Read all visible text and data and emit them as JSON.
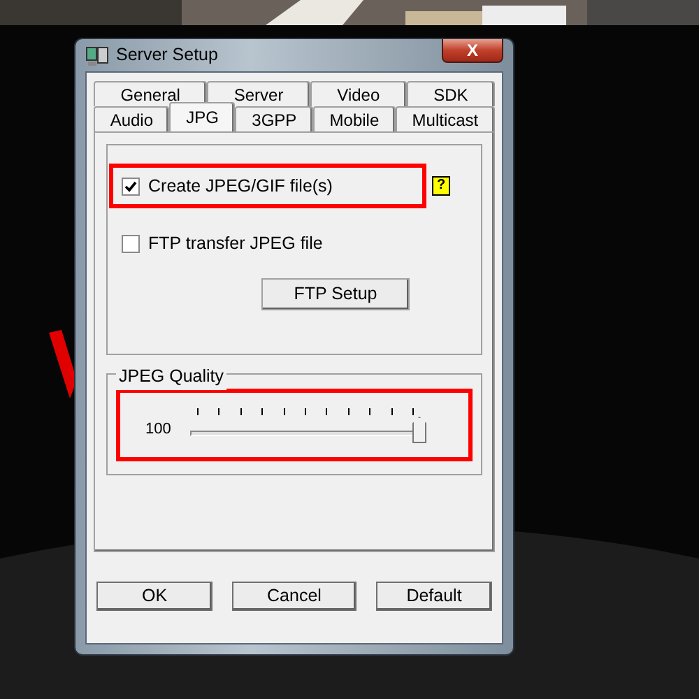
{
  "window": {
    "title": "Server Setup",
    "close": "X"
  },
  "tabs": [
    [
      {
        "label": "General",
        "selected": false
      },
      {
        "label": "Server",
        "selected": false
      },
      {
        "label": "Video",
        "selected": false
      },
      {
        "label": "SDK",
        "selected": false
      }
    ],
    [
      {
        "label": "Audio",
        "selected": false
      },
      {
        "label": "JPG",
        "selected": true
      },
      {
        "label": "3GPP",
        "selected": false
      },
      {
        "label": "Mobile",
        "selected": false
      },
      {
        "label": "Multicast",
        "selected": false
      }
    ]
  ],
  "options": [
    {
      "label": "Create JPEG/GIF file(s)",
      "checked": true,
      "highlighted": true,
      "help": "?"
    },
    {
      "label": "FTP transfer JPEG file",
      "checked": false,
      "highlighted": false
    }
  ],
  "ftp_button": "FTP Setup",
  "quality": {
    "title": "JPEG Quality",
    "reading": "100",
    "level": 1.0,
    "highlighted": true
  },
  "buttons": [
    "OK",
    "Cancel",
    "Default"
  ]
}
